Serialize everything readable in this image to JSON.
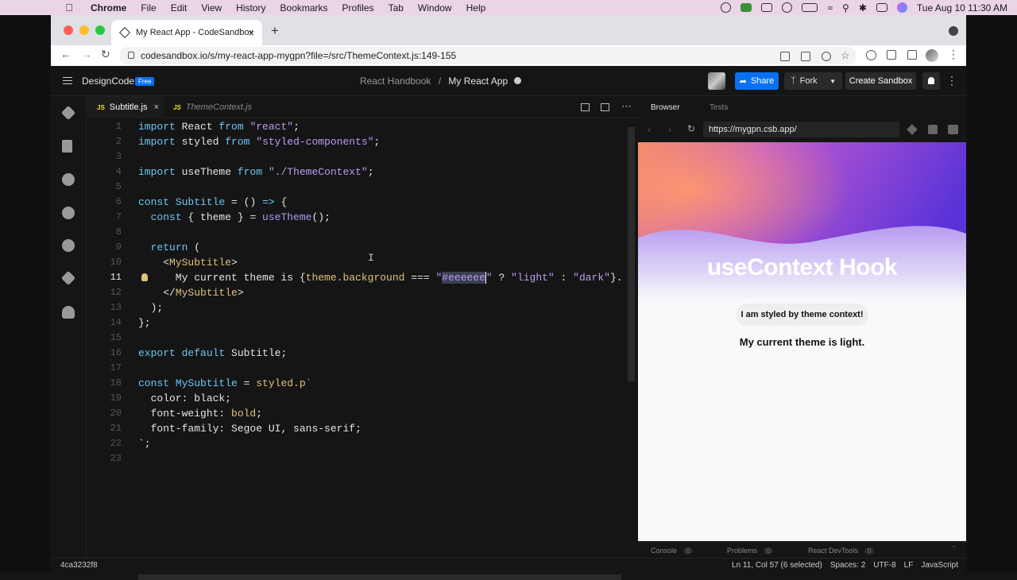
{
  "menubar": {
    "app": "Chrome",
    "items": [
      "File",
      "Edit",
      "View",
      "History",
      "Bookmarks",
      "Profiles",
      "Tab",
      "Window",
      "Help"
    ],
    "clock": "Tue Aug 10  11:30 AM"
  },
  "browser": {
    "tab_title": "My React App - CodeSandbox",
    "url": "codesandbox.io/s/my-react-app-mygpn?file=/src/ThemeContext.js:149-155"
  },
  "csb": {
    "brand": "DesignCode",
    "badge": "Free",
    "crumb_parent": "React Handbook",
    "crumb_sep": "/",
    "crumb_current": "My React App",
    "share": "Share",
    "fork": "Fork",
    "create": "Create Sandbox"
  },
  "editor": {
    "tabs": [
      {
        "label": "Subtitle.js",
        "active": true
      },
      {
        "label": "ThemeContext.js",
        "active": false
      }
    ],
    "current_line": 11,
    "lines": [
      {
        "n": "1"
      },
      {
        "n": "2"
      },
      {
        "n": "3"
      },
      {
        "n": "4"
      },
      {
        "n": "5"
      },
      {
        "n": "6"
      },
      {
        "n": "7"
      },
      {
        "n": "8"
      },
      {
        "n": "9"
      },
      {
        "n": "10"
      },
      {
        "n": "11"
      },
      {
        "n": "12"
      },
      {
        "n": "13"
      },
      {
        "n": "14"
      },
      {
        "n": "15"
      },
      {
        "n": "16"
      },
      {
        "n": "17"
      },
      {
        "n": "18"
      },
      {
        "n": "19"
      },
      {
        "n": "20"
      },
      {
        "n": "21"
      },
      {
        "n": "22"
      },
      {
        "n": "23"
      }
    ],
    "code": {
      "l1": [
        "import",
        " React ",
        "from",
        " ",
        "\"react\"",
        ";"
      ],
      "l2": [
        "import",
        " styled ",
        "from",
        " ",
        "\"styled-components\"",
        ";"
      ],
      "l4": [
        "import",
        " useTheme ",
        "from",
        " ",
        "\"./ThemeContext\"",
        ";"
      ],
      "l6": [
        "const",
        " ",
        "Subtitle",
        " = () ",
        "=>",
        " {"
      ],
      "l7": [
        "  ",
        "const",
        " { theme } = ",
        "useTheme",
        "();"
      ],
      "l9": [
        "  ",
        "return",
        " ("
      ],
      "l10": [
        "    <",
        "MySubtitle",
        ">"
      ],
      "l11": [
        "      My current theme is {",
        "theme.background",
        " === ",
        "\"",
        "#eeeeee",
        "\"",
        " ? ",
        "\"light\"",
        " : ",
        "\"dark\"",
        "}."
      ],
      "l12": [
        "    </",
        "MySubtitle",
        ">"
      ],
      "l13": [
        "  );"
      ],
      "l14": [
        "};"
      ],
      "l16": [
        "export",
        " ",
        "default",
        " Subtitle;"
      ],
      "l18": [
        "const",
        " ",
        "MySubtitle",
        " = ",
        "styled.p",
        "`"
      ],
      "l19": [
        "  color: black;"
      ],
      "l20": [
        "  font-weight: ",
        "bold",
        ";"
      ],
      "l21": [
        "  font-family: ",
        "Segoe UI, sans-serif",
        ";"
      ],
      "l22": [
        "`;"
      ]
    }
  },
  "preview": {
    "tab_browser": "Browser",
    "tab_tests": "Tests",
    "url": "https://mygpn.csb.app/",
    "heading": "useContext Hook",
    "pill": "I am styled by theme context!",
    "theme_text": "My current theme is light."
  },
  "devtools": {
    "console": "Console",
    "console_count": "0",
    "problems": "Problems",
    "problems_count": "0",
    "react": "React DevTools",
    "react_count": "0"
  },
  "status": {
    "commit": "4ca3232f8",
    "position": "Ln 11, Col 57 (6 selected)",
    "spaces": "Spaces: 2",
    "encoding": "UTF-8",
    "eol": "LF",
    "language": "JavaScript"
  },
  "colors": {
    "accent": "#0971f1",
    "keyword": "#6cc7f6",
    "string": "#bf9bf4",
    "tag": "#e1c07a"
  }
}
